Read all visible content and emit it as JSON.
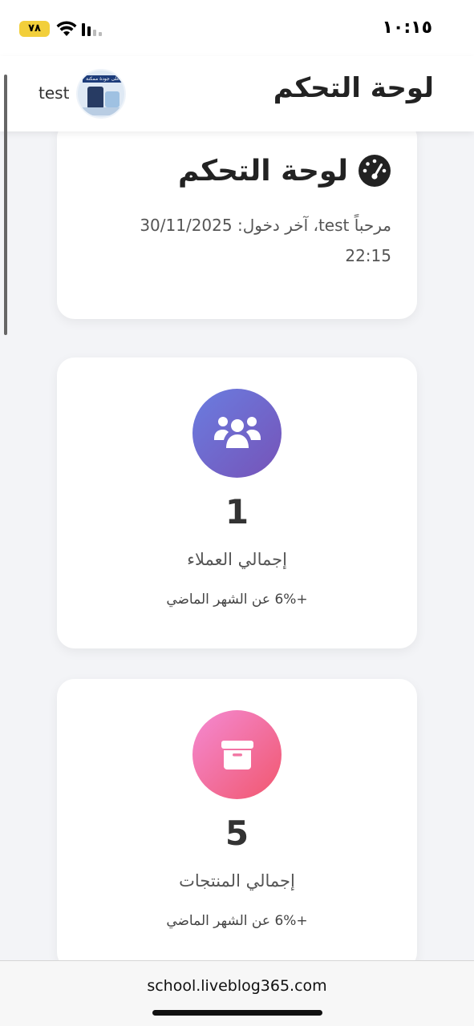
{
  "status_bar": {
    "time": "١٠:١٥",
    "battery": "٧٨",
    "icons": [
      "wifi-icon",
      "signal-icon"
    ]
  },
  "header": {
    "title": "لوحة التحكم",
    "username": "test",
    "avatar_banner": "أعلى جودة ممكنة"
  },
  "welcome": {
    "icon": "tachometer-icon",
    "title": "لوحة التحكم",
    "text": "مرحباً test، آخر دخول: 30/11/2025 22:15"
  },
  "stats": [
    {
      "icon": "users-icon",
      "value": "1",
      "label": "إجمالي العملاء",
      "change": "+6% عن الشهر الماضي",
      "color": "#6f63c9"
    },
    {
      "icon": "box-icon",
      "value": "5",
      "label": "إجمالي المنتجات",
      "change": "+6% عن الشهر الماضي",
      "color": "#f16f9f"
    }
  ],
  "browser": {
    "url": "school.liveblog365.com"
  }
}
